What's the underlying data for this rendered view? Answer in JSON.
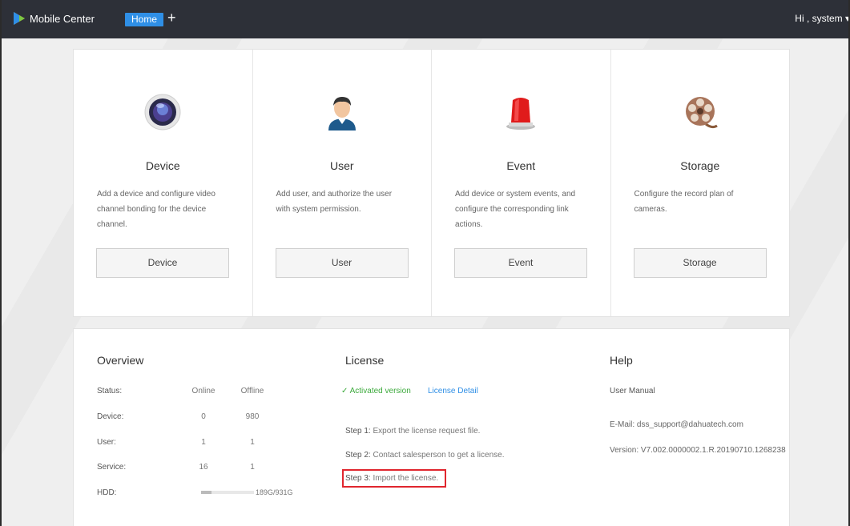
{
  "header": {
    "app_title": "Mobile Center",
    "home_tab": "Home",
    "add_tab": "+",
    "user_menu": "Hi , system ▾"
  },
  "modules": [
    {
      "title": "Device",
      "description": "Add a device and configure video channel bonding for the device channel.",
      "button": "Device",
      "icon": "camera-lens-icon"
    },
    {
      "title": "User",
      "description": "Add user, and authorize the user with system permission.",
      "button": "User",
      "icon": "user-avatar-icon"
    },
    {
      "title": "Event",
      "description": "Add device or system events, and configure the corresponding link actions.",
      "button": "Event",
      "icon": "alarm-light-icon"
    },
    {
      "title": "Storage",
      "description": "Configure the record plan of cameras.",
      "button": "Storage",
      "icon": "film-reel-icon"
    }
  ],
  "overview": {
    "title": "Overview",
    "columns": [
      "Status:",
      "Online",
      "Offline"
    ],
    "rows": [
      {
        "label": "Device:",
        "online": "0",
        "offline": "980"
      },
      {
        "label": "User:",
        "online": "1",
        "offline": "1"
      },
      {
        "label": "Service:",
        "online": "16",
        "offline": "1"
      }
    ],
    "hdd_label": "HDD:",
    "hdd_usage": "189G/931G",
    "hdd_fraction": 0.2
  },
  "license": {
    "title": "License",
    "status": "✓ Activated version",
    "detail_link": "License Detail",
    "steps": [
      {
        "label": "Step 1:",
        "text": "Export the license request file."
      },
      {
        "label": "Step 2:",
        "text": "Contact salesperson to get a license."
      },
      {
        "label": "Step 3:",
        "text": "Import the license."
      }
    ]
  },
  "help": {
    "title": "Help",
    "manual": "User Manual",
    "email_label": "E-Mail:",
    "email": "dss_support@dahuatech.com",
    "version_label": "Version:",
    "version": "V7.002.0000002.1.R.20190710.1268238"
  },
  "colors": {
    "topbar": "#2d3038",
    "accent": "#2f8fe6",
    "success": "#3daa3d",
    "highlight": "#e0262e"
  }
}
